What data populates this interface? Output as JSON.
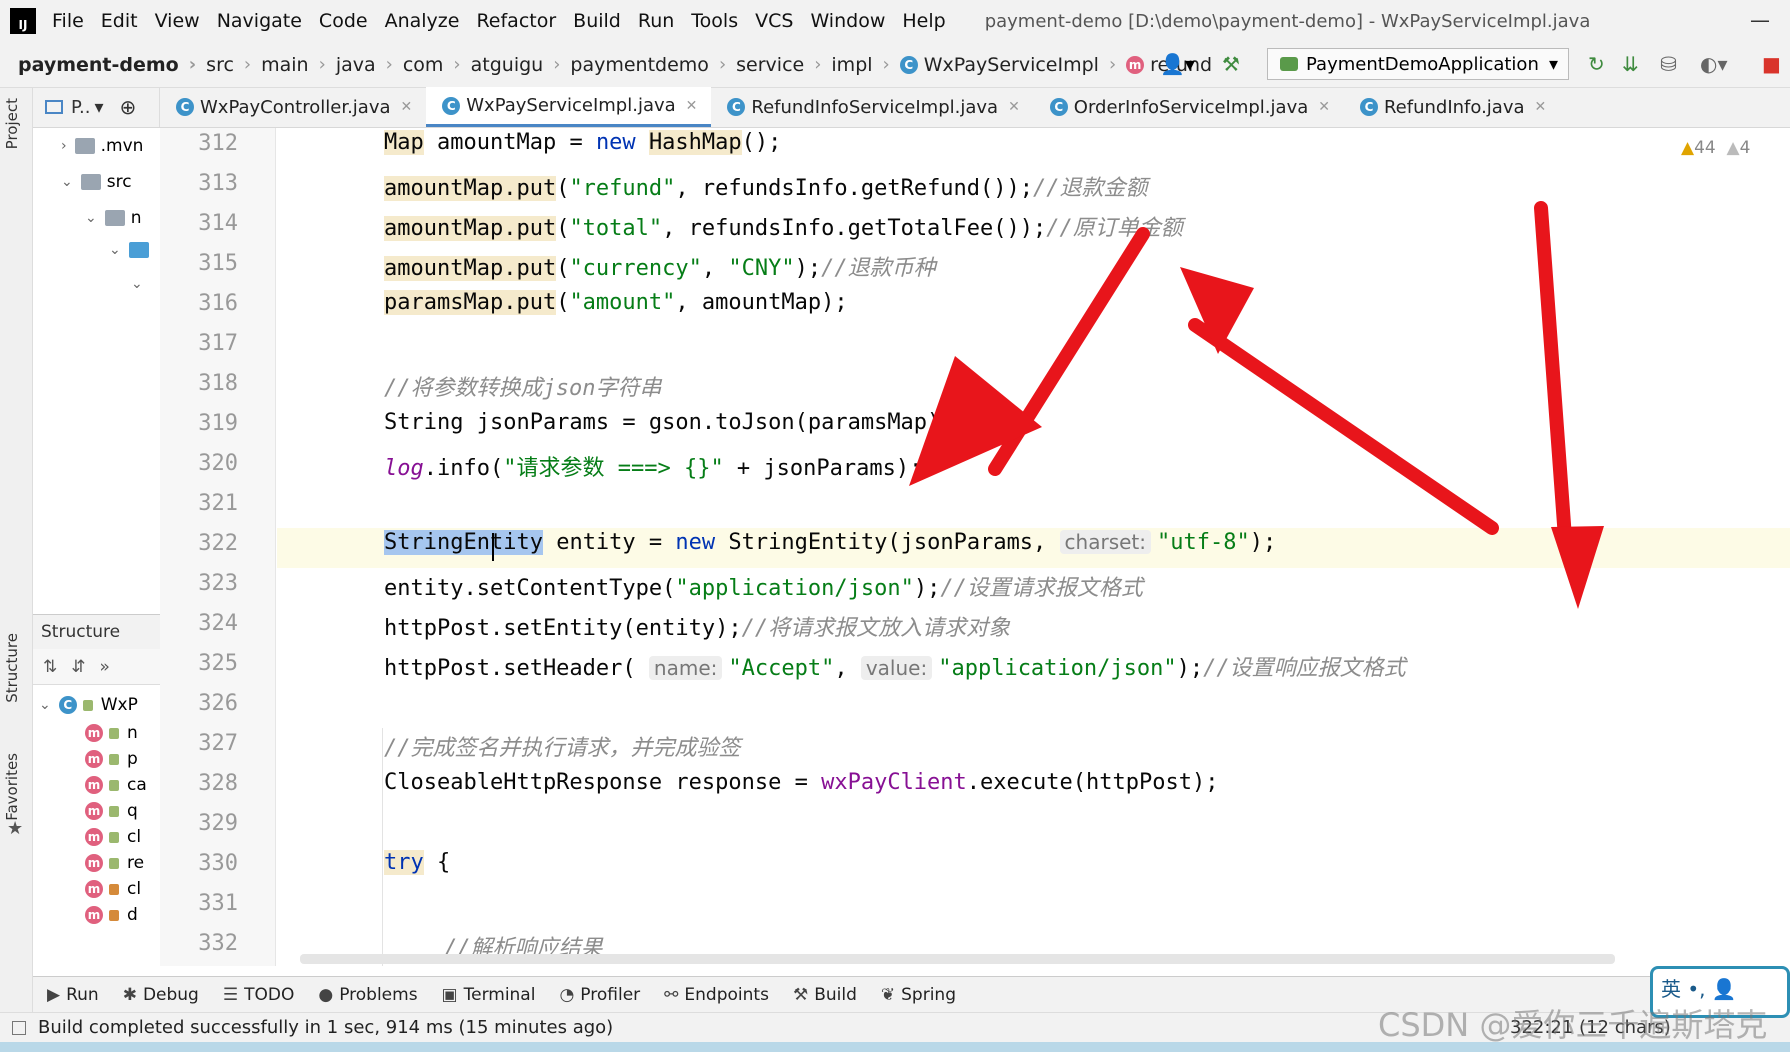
{
  "menu": {
    "items": [
      "File",
      "Edit",
      "View",
      "Navigate",
      "Code",
      "Analyze",
      "Refactor",
      "Build",
      "Run",
      "Tools",
      "VCS",
      "Window",
      "Help"
    ],
    "window_title": "payment-demo [D:\\demo\\payment-demo] - WxPayServiceImpl.java"
  },
  "breadcrumb": [
    "payment-demo",
    "src",
    "main",
    "java",
    "com",
    "atguigu",
    "paymentdemo",
    "service",
    "impl",
    "WxPayServiceImpl",
    "refund"
  ],
  "run_config": "PaymentDemoApplication",
  "project_header": "P..",
  "tabs": [
    "WxPayController.java",
    "WxPayServiceImpl.java",
    "RefundInfoServiceImpl.java",
    "OrderInfoServiceImpl.java",
    "RefundInfo.java"
  ],
  "project_tree": [
    ".mvn",
    "src",
    "n"
  ],
  "side_labels": {
    "project": "Project",
    "structure": "Structure",
    "favorites": "Favorites"
  },
  "structure": {
    "title": "Structure",
    "root": "WxP",
    "items": [
      "n",
      "p",
      "ca",
      "q",
      "cl",
      "re",
      "cl",
      "d"
    ]
  },
  "inspections": {
    "warnings": "44",
    "weak_warnings": "4"
  },
  "editor": {
    "line_numbers": [
      "312",
      "313",
      "314",
      "315",
      "316",
      "317",
      "318",
      "319",
      "320",
      "321",
      "322",
      "323",
      "324",
      "325",
      "326",
      "327",
      "328",
      "329",
      "330",
      "331",
      "332"
    ],
    "l312": {
      "a": "Map",
      "b": " amountMap = ",
      "c": "new",
      "d": " ",
      "e": "HashMap",
      "f": "();"
    },
    "l313": {
      "a": "amountMap.put",
      "b": "(",
      "c": "\"refund\"",
      "d": ", refundsInfo.getRefund());",
      "e": "//退款金额"
    },
    "l314": {
      "a": "amountMap.put",
      "b": "(",
      "c": "\"total\"",
      "d": ", refundsInfo.getTotalFee());",
      "e": "//原订单金额"
    },
    "l315": {
      "a": "amountMap.put",
      "b": "(",
      "c": "\"currency\"",
      "d": ", ",
      "e": "\"CNY\"",
      "f": ");",
      "g": "//退款币种"
    },
    "l316": {
      "a": "paramsMap.put",
      "b": "(",
      "c": "\"amount\"",
      "d": ", amountMap);"
    },
    "l318": {
      "a": "//将参数转换成json字符串"
    },
    "l319": {
      "a": "String jsonParams = gson.toJson(paramsMap);"
    },
    "l320": {
      "a": "log",
      "b": ".info(",
      "c": "\"请求参数 ===> {}\"",
      "d": " + jsonParams);"
    },
    "l322": {
      "a": "StringEntity",
      "b": " entity = ",
      "c": "new",
      "d": " ",
      "e": "StringEntity",
      "f": "(jsonParams, ",
      "g": "charset:",
      "h": "\"utf-8\"",
      "i": ");"
    },
    "l323": {
      "a": "entity.setContentType(",
      "b": "\"application/json\"",
      "c": ");",
      "d": "//设置请求报文格式"
    },
    "l324": {
      "a": "httpPost.setEntity(entity);",
      "b": "//将请求报文放入请求对象"
    },
    "l325": {
      "a": "httpPost.setHeader( ",
      "b": "name:",
      "c": "\"Accept\"",
      "d": ", ",
      "e": "value:",
      "f": "\"application/json\"",
      "g": ");",
      "h": "//设置响应报文格式"
    },
    "l327": {
      "a": "//完成签名并执行请求，并完成验签"
    },
    "l328": {
      "a": "CloseableHttpResponse response = ",
      "b": "wxPayClient",
      "c": ".execute(httpPost);"
    },
    "l330": {
      "a": "try",
      "b": " {"
    },
    "l332": {
      "a": "//解析响应结果"
    }
  },
  "tool_windows": [
    "Run",
    "Debug",
    "TODO",
    "Problems",
    "Terminal",
    "Profiler",
    "Endpoints",
    "Build",
    "Spring"
  ],
  "status": {
    "message": "Build completed successfully in 1 sec, 914 ms (15 minutes ago)",
    "position": "322:21 (12 chars)"
  },
  "ime": {
    "lang": "英"
  },
  "watermark": "CSDN @爱你三千遍斯塔克",
  "colors": {
    "arrow": "#e8151b",
    "keyword": "#0033b3",
    "string": "#067d17",
    "comment": "#8c8c8c",
    "selection": "#a6c6ef"
  }
}
